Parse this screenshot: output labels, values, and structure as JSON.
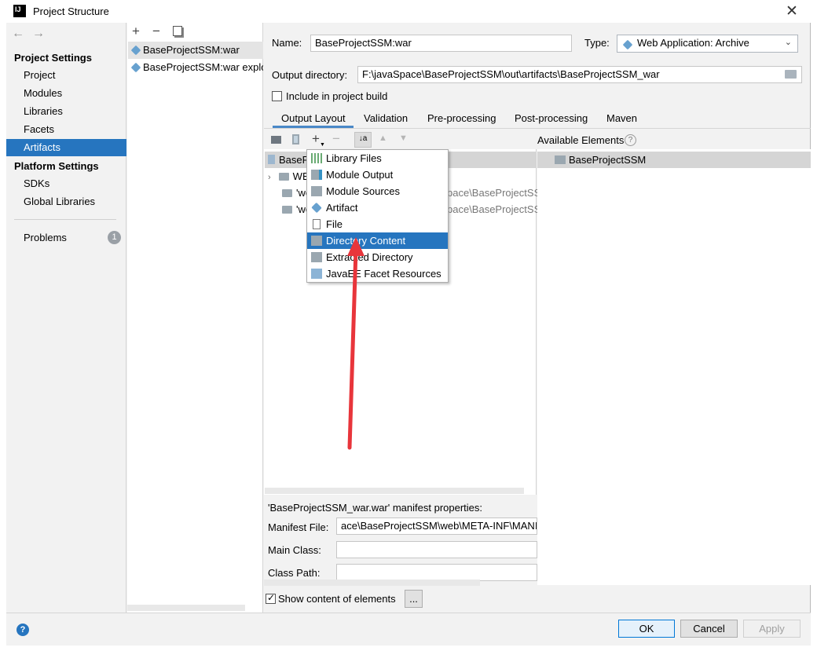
{
  "window": {
    "title": "Project Structure"
  },
  "sidebar": {
    "project_settings_header": "Project Settings",
    "items": [
      "Project",
      "Modules",
      "Libraries",
      "Facets",
      "Artifacts"
    ],
    "platform_settings_header": "Platform Settings",
    "platform_items": [
      "SDKs",
      "Global Libraries"
    ],
    "problems_label": "Problems",
    "problems_count": "1"
  },
  "artifacts": {
    "items": [
      "BaseProjectSSM:war",
      "BaseProjectSSM:war exploded"
    ]
  },
  "form": {
    "name_label": "Name:",
    "name_value": "BaseProjectSSM:war",
    "type_label": "Type:",
    "type_value": "Web Application: Archive",
    "output_dir_label": "Output directory:",
    "output_dir_value": "F:\\javaSpace\\BaseProjectSSM\\out\\artifacts\\BaseProjectSSM_war",
    "include_build_label": "Include in project build"
  },
  "tabs": [
    "Output Layout",
    "Validation",
    "Pre-processing",
    "Post-processing",
    "Maven"
  ],
  "layout_tree": {
    "root": "BaseP",
    "row1": "WE",
    "row2_prefix": "'we",
    "row2_suffix": "pace\\BaseProjectSS",
    "row3_prefix": "'we",
    "row3_suffix": "pace\\BaseProjectSS"
  },
  "add_menu": {
    "items": [
      "Library Files",
      "Module Output",
      "Module Sources",
      "Artifact",
      "File",
      "Directory Content",
      "Extracted Directory",
      "JavaEE Facet Resources"
    ],
    "selected": "Directory Content"
  },
  "available": {
    "header": "Available Elements",
    "item": "BaseProjectSSM"
  },
  "manifest": {
    "title": "'BaseProjectSSM_war.war' manifest properties:",
    "file_label": "Manifest File:",
    "file_value": "ace\\BaseProjectSSM\\web\\META-INF\\MANI",
    "main_class_label": "Main Class:",
    "class_path_label": "Class Path:"
  },
  "show_content_label": "Show content of elements",
  "ellipsis_button": "...",
  "buttons": {
    "ok": "OK",
    "cancel": "Cancel",
    "apply": "Apply"
  },
  "colors": {
    "selection": "#2675bf",
    "annotation_arrow": "#e8353b"
  }
}
